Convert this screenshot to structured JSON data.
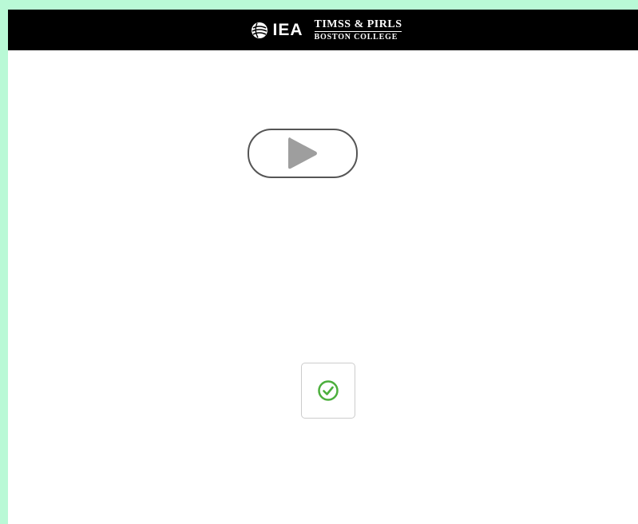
{
  "header": {
    "logo_text": "IEA",
    "org_line1": "TIMSS & PIRLS",
    "org_line2": "BOSTON COLLEGE"
  },
  "player": {
    "icon": "play-icon"
  },
  "confirm": {
    "icon": "check-circle-icon"
  },
  "colors": {
    "background": "#b9f9d6",
    "header": "#000000",
    "play_icon": "#9e9e9e",
    "check_icon": "#4caf3d"
  }
}
